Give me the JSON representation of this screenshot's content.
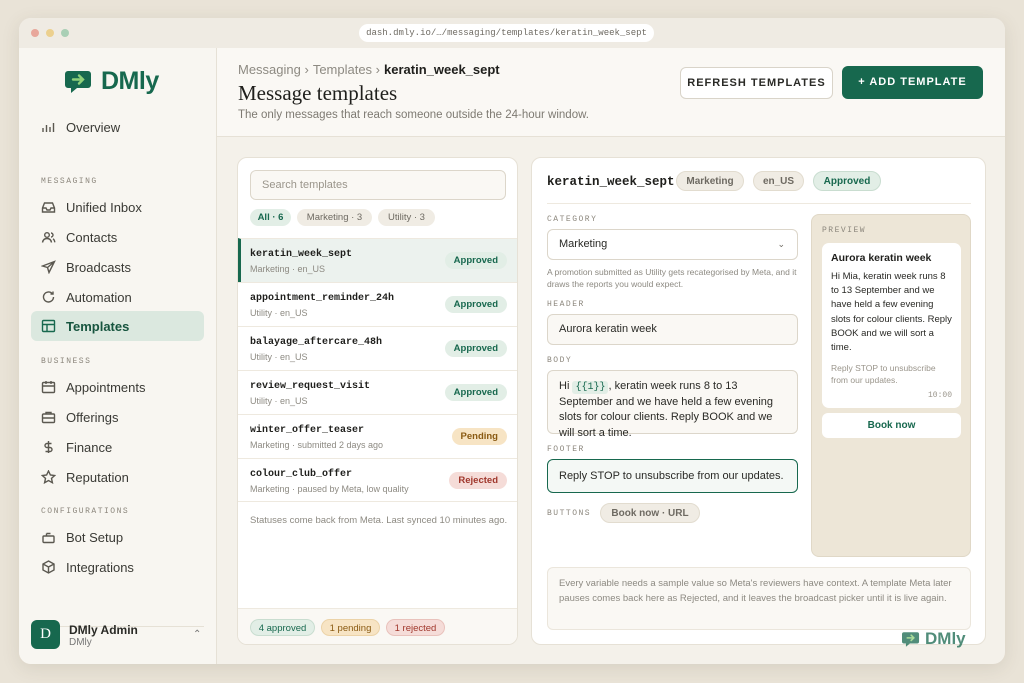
{
  "browser": {
    "url": "dash.dmly.io/…/messaging/templates/keratin_week_sept"
  },
  "brand": {
    "name": "DMly",
    "accent": "#17684e"
  },
  "sidebar": {
    "overview": "Overview",
    "sections": {
      "messaging": "MESSAGING",
      "business": "BUSINESS",
      "configurations": "CONFIGURATIONS"
    },
    "items": {
      "inbox": "Unified Inbox",
      "contacts": "Contacts",
      "broadcasts": "Broadcasts",
      "automation": "Automation",
      "templates": "Templates",
      "appointments": "Appointments",
      "offerings": "Offerings",
      "finance": "Finance",
      "reputation": "Reputation",
      "bot": "Bot Setup",
      "integrations": "Integrations"
    },
    "user": {
      "initial": "D",
      "name": "DMly Admin",
      "org": "DMly"
    }
  },
  "header": {
    "crumb1": "Messaging ›",
    "crumb2": "Templates ›",
    "crumb3": "keratin_week_sept",
    "title": "Message templates",
    "subtitle": "The only messages that reach someone outside the 24-hour window.",
    "refresh_label": "REFRESH TEMPLATES",
    "add_label": "+  ADD TEMPLATE"
  },
  "list": {
    "search_placeholder": "Search templates",
    "filters": {
      "all": "All · 6",
      "marketing": "Marketing · 3",
      "utility": "Utility · 3"
    },
    "rows": [
      {
        "name": "keratin_week_sept",
        "sub": "Marketing · en_US",
        "status": "Approved"
      },
      {
        "name": "appointment_reminder_24h",
        "sub": "Utility · en_US",
        "status": "Approved"
      },
      {
        "name": "balayage_aftercare_48h",
        "sub": "Utility · en_US",
        "status": "Approved"
      },
      {
        "name": "review_request_visit",
        "sub": "Utility · en_US",
        "status": "Approved"
      },
      {
        "name": "winter_offer_teaser",
        "sub": "Marketing · submitted 2 days ago",
        "status": "Pending"
      },
      {
        "name": "colour_club_offer",
        "sub": "Marketing · paused by Meta, low quality",
        "status": "Rejected"
      }
    ],
    "note": "Statuses come back from Meta. Last synced 10 minutes ago.",
    "summary": {
      "approved": "4 approved",
      "pending": "1 pending",
      "rejected": "1 rejected"
    }
  },
  "detail": {
    "name": "keratin_week_sept",
    "category_chip": "Marketing",
    "locale_chip": "en_US",
    "status_chip": "Approved",
    "labels": {
      "category": "CATEGORY",
      "header": "HEADER",
      "body": "BODY",
      "footer": "FOOTER",
      "buttons": "BUTTONS",
      "preview": "PREVIEW"
    },
    "category_value": "Marketing",
    "category_hint": "A promotion submitted as Utility gets recategorised by Meta, and it draws the reports you would expect.",
    "header_value": "Aurora keratin week",
    "body_prefix": "Hi ",
    "body_var": "{{1}}",
    "body_suffix": ", keratin week runs 8 to 13 September and we have held a few evening slots for colour clients. Reply BOOK and we will sort a time.",
    "footer_value": "Reply STOP to unsubscribe from our updates.",
    "button_chip": "Book now · URL",
    "preview": {
      "title": "Aurora keratin week",
      "body": "Hi Mia, keratin week runs 8 to 13 September and we have held a few evening slots for colour clients. Reply BOOK and we will sort a time.",
      "footer": "Reply STOP to unsubscribe from our updates.",
      "time": "10:00",
      "button": "Book now"
    },
    "info": "Every variable needs a sample value so Meta's reviewers have context. A template Meta later pauses comes back here as Rejected, and it leaves the broadcast picker until it is live again."
  }
}
